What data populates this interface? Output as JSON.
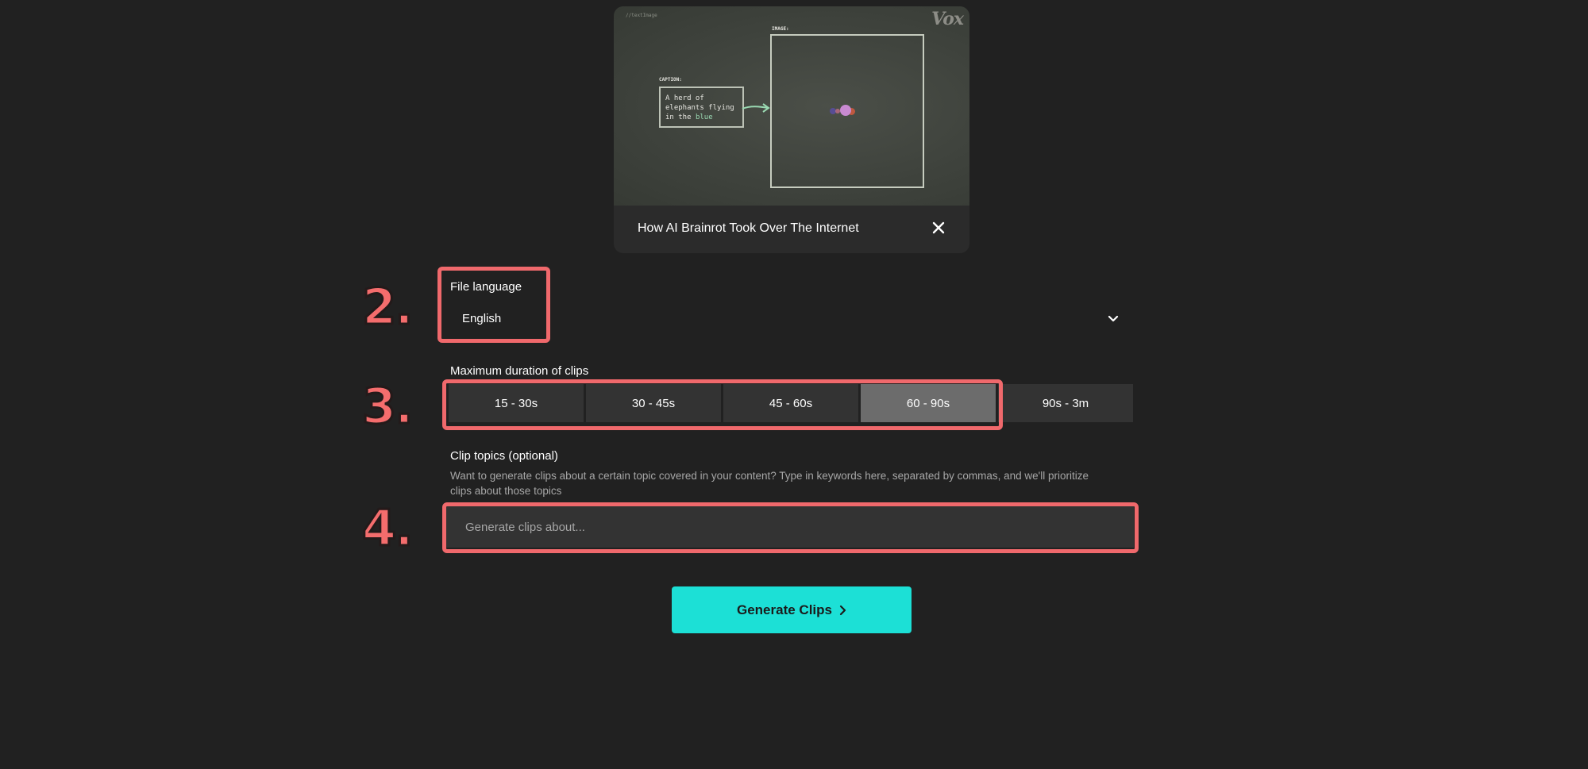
{
  "video": {
    "title": "How AI Brainrot Took Over The Internet",
    "thumbnail": {
      "tag": "//textImage",
      "logo": "Vox",
      "caption_label": "CAPTION:",
      "image_label": "IMAGE:",
      "caption_line1": "A herd of",
      "caption_line2": "elephants flying",
      "caption_line3_prefix": "in the ",
      "caption_line3_highlight": "blue"
    }
  },
  "steps": {
    "language": "2.",
    "duration": "3.",
    "topics": "4."
  },
  "language": {
    "label": "File language",
    "value": "English"
  },
  "duration": {
    "label": "Maximum duration of clips",
    "options": [
      "15 - 30s",
      "30 - 45s",
      "45 - 60s",
      "60 - 90s",
      "90s - 3m"
    ],
    "selected": "60 - 90s"
  },
  "topics": {
    "label": "Clip topics (optional)",
    "helper": "Want to generate clips about a certain topic covered in your content? Type in keywords here, separated by commas, and we'll prioritize clips about those topics",
    "placeholder": "Generate clips about..."
  },
  "generate": {
    "label": "Generate Clips"
  },
  "colors": {
    "background": "#212121",
    "highlight": "#f0696c",
    "accent": "#1ce0d6",
    "selected_option": "#6c6c6c"
  },
  "icons": {
    "close": "close-icon",
    "dropdown": "chevron-down-icon",
    "generate": "chevron-right-icon"
  }
}
